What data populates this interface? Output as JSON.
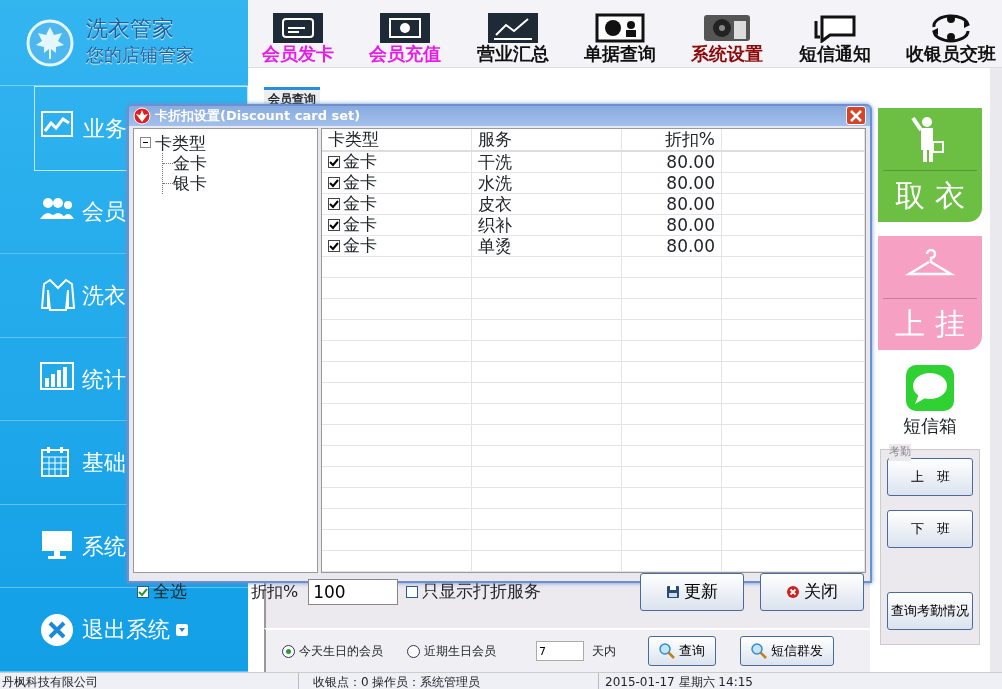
{
  "sidebar": {
    "logo_title": "洗衣管家",
    "logo_subtitle": "您的店铺管家",
    "items": [
      {
        "label": "业务",
        "kind": "chart",
        "selected": true
      },
      {
        "label": "会员",
        "kind": "people",
        "selected": false
      },
      {
        "label": "洗衣",
        "kind": "shirt",
        "selected": false
      },
      {
        "label": "统计",
        "kind": "bars",
        "selected": false
      },
      {
        "label": "基础",
        "kind": "calendar",
        "selected": false
      },
      {
        "label": "系统",
        "kind": "monitor",
        "selected": false
      },
      {
        "label": "退出系统",
        "kind": "exit",
        "selected": false
      }
    ]
  },
  "toolbar": {
    "buttons": [
      {
        "label": "会员发卡",
        "kind": "card",
        "color": "#e61ee6"
      },
      {
        "label": "会员充值",
        "kind": "cash",
        "color": "#e61ee6"
      },
      {
        "label": "营业汇总",
        "kind": "chart",
        "color": "#111111"
      },
      {
        "label": "单据查询",
        "kind": "screen",
        "color": "#111111"
      },
      {
        "label": "系统设置",
        "kind": "gear",
        "color": "#8b0a0a"
      },
      {
        "label": "短信通知",
        "kind": "chat",
        "color": "#111111"
      },
      {
        "label": "收银员交班",
        "kind": "swap",
        "color": "#111111"
      }
    ]
  },
  "content": {
    "tab": "会员查询",
    "birthday_options": [
      {
        "label": "今天生日的会员",
        "selected": true
      },
      {
        "label": "近期生日会员",
        "selected": false
      }
    ],
    "days_value": "7",
    "days_unit": "天内",
    "buttons": [
      "查询",
      "短信群发"
    ]
  },
  "right_panel": {
    "tiles": [
      {
        "label": "取 衣",
        "kind": "pickup"
      },
      {
        "label": "上 挂",
        "kind": "hanger"
      }
    ],
    "sms_label": "短信箱",
    "attendance": {
      "title": "考勤",
      "buttons": [
        "上　班",
        "下　班",
        "查询考勤情况"
      ]
    }
  },
  "dialog": {
    "title": "卡折扣设置(Discount card set)",
    "tree": {
      "label": "卡类型",
      "expanded": true,
      "children": [
        {
          "label": "金卡"
        },
        {
          "label": "银卡"
        }
      ]
    },
    "columns": [
      "卡类型",
      "服务",
      "折扣%"
    ],
    "rows": [
      {
        "card_type": "金卡",
        "checked": true,
        "service": "干洗",
        "discount": "80.00"
      },
      {
        "card_type": "金卡",
        "checked": true,
        "service": "水洗",
        "discount": "80.00"
      },
      {
        "card_type": "金卡",
        "checked": true,
        "service": "皮衣",
        "discount": "80.00"
      },
      {
        "card_type": "金卡",
        "checked": true,
        "service": "织补",
        "discount": "80.00"
      },
      {
        "card_type": "金卡",
        "checked": true,
        "service": "单烫",
        "discount": "80.00"
      }
    ],
    "select_all": {
      "label": "全选",
      "checked": true
    },
    "discount_label": "折扣%",
    "discount_value": "100",
    "only_discounted": {
      "label": "只显示打折服务",
      "checked": false
    },
    "buttons": [
      {
        "label": "更新",
        "kind": "save"
      },
      {
        "label": "关闭",
        "kind": "close"
      }
    ]
  },
  "status_bar": {
    "company": "丹枫科技有限公司",
    "station": "收银点：0  操作员：系统管理员",
    "datetime": "2015-01-17  星期六 14:15"
  }
}
